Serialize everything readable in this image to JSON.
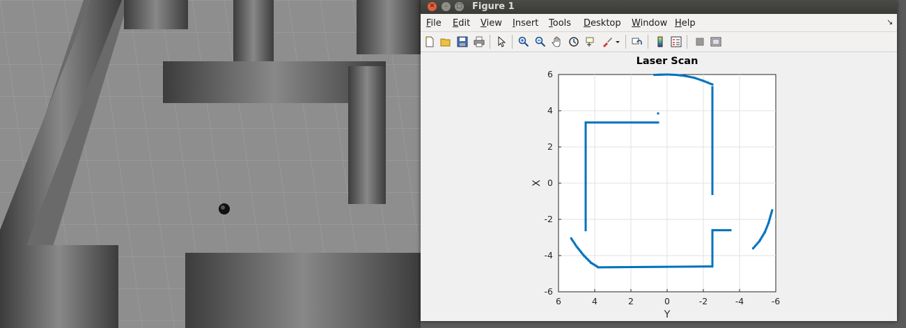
{
  "window": {
    "title": "Figure 1"
  },
  "menu": [
    {
      "label": "File",
      "key": "F",
      "rest": "ile"
    },
    {
      "label": "Edit",
      "key": "E",
      "rest": "dit"
    },
    {
      "label": "View",
      "key": "V",
      "rest": "iew"
    },
    {
      "label": "Insert",
      "key": "I",
      "rest": "nsert"
    },
    {
      "label": "Tools",
      "key": "T",
      "rest": "ools"
    },
    {
      "label": "Desktop",
      "key": "D",
      "rest": "esktop"
    },
    {
      "label": "Window",
      "key": "W",
      "rest": "indow"
    },
    {
      "label": "Help",
      "key": "H",
      "rest": "elp"
    }
  ],
  "toolbar": {
    "icons": [
      "new-figure-icon",
      "open-file-icon",
      "save-icon",
      "print-icon",
      "edit-plot-arrow-icon",
      "zoom-in-icon",
      "zoom-out-icon",
      "pan-hand-icon",
      "rotate-3d-icon",
      "data-cursor-icon",
      "brush-icon",
      "brush-dropdown-icon",
      "link-plot-icon",
      "colorbar-icon",
      "legend-icon",
      "hide-plot-tools-icon",
      "show-plot-tools-icon"
    ]
  },
  "chart_data": {
    "type": "scatter",
    "title": "Laser Scan",
    "xlabel": "Y",
    "ylabel": "X",
    "xlim": [
      6,
      -6
    ],
    "ylim": [
      -6,
      6
    ],
    "x_reversed": true,
    "xticks": [
      6,
      4,
      2,
      0,
      -2,
      -4,
      -6
    ],
    "yticks": [
      6,
      4,
      2,
      0,
      -2,
      -4,
      -6
    ],
    "grid": true,
    "marker_color": "#0072BD",
    "segments": [
      {
        "name": "top-arc",
        "points": [
          [
            0.7,
            5.98
          ],
          [
            0.4,
            5.99
          ],
          [
            0,
            6
          ],
          [
            -0.5,
            5.98
          ],
          [
            -1,
            5.92
          ],
          [
            -1.5,
            5.82
          ],
          [
            -2,
            5.65
          ],
          [
            -2.5,
            5.45
          ]
        ]
      },
      {
        "name": "right-wall-upper",
        "points": [
          [
            -2.5,
            5.3
          ],
          [
            -2.5,
            -0.6
          ]
        ]
      },
      {
        "name": "top-left-wall",
        "points": [
          [
            4.5,
            3.35
          ],
          [
            0.5,
            3.35
          ]
        ]
      },
      {
        "name": "isolated-point",
        "points": [
          [
            0.5,
            3.85
          ]
        ]
      },
      {
        "name": "left-wall",
        "points": [
          [
            4.5,
            3.35
          ],
          [
            4.5,
            -2.6
          ]
        ]
      },
      {
        "name": "bottom-wall",
        "points": [
          [
            3.8,
            -4.65
          ],
          [
            -2.5,
            -4.6
          ]
        ]
      },
      {
        "name": "lower-right-post",
        "points": [
          [
            -2.5,
            -4.6
          ],
          [
            -2.5,
            -2.6
          ]
        ]
      },
      {
        "name": "lower-right-stub",
        "points": [
          [
            -2.5,
            -2.6
          ],
          [
            -3.5,
            -2.6
          ]
        ]
      },
      {
        "name": "bottom-left-arc",
        "points": [
          [
            5.3,
            -3.05
          ],
          [
            5.0,
            -3.5
          ],
          [
            4.6,
            -4.0
          ],
          [
            4.2,
            -4.4
          ],
          [
            3.8,
            -4.65
          ]
        ]
      },
      {
        "name": "right-arc",
        "points": [
          [
            -4.75,
            -3.6
          ],
          [
            -5.1,
            -3.2
          ],
          [
            -5.4,
            -2.7
          ],
          [
            -5.6,
            -2.2
          ],
          [
            -5.8,
            -1.5
          ]
        ]
      }
    ]
  }
}
